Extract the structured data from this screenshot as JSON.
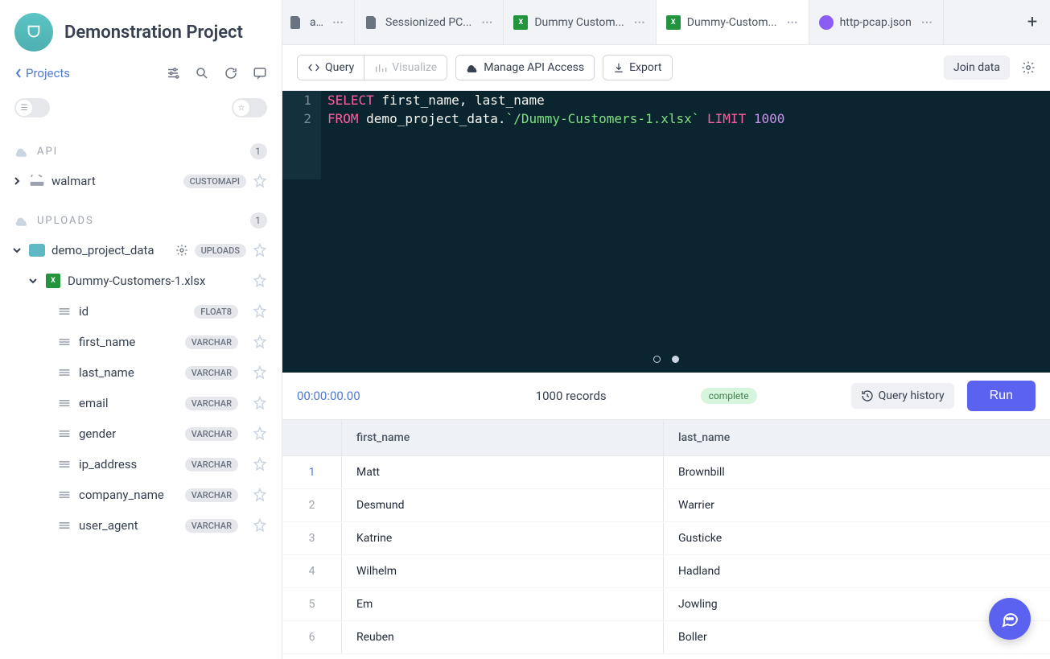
{
  "project": {
    "name": "Demonstration Project",
    "back_link": "Projects"
  },
  "sidebar": {
    "api_label": "API",
    "api_count": "1",
    "api_items": [
      {
        "name": "walmart",
        "badge": "CUSTOMAPI"
      }
    ],
    "uploads_label": "UPLOADS",
    "uploads_count": "1",
    "uploads_folder": {
      "name": "demo_project_data",
      "badge": "UPLOADS"
    },
    "file": {
      "name": "Dummy-Customers-1.xlsx"
    },
    "columns": [
      {
        "name": "id",
        "type": "FLOAT8"
      },
      {
        "name": "first_name",
        "type": "VARCHAR"
      },
      {
        "name": "last_name",
        "type": "VARCHAR"
      },
      {
        "name": "email",
        "type": "VARCHAR"
      },
      {
        "name": "gender",
        "type": "VARCHAR"
      },
      {
        "name": "ip_address",
        "type": "VARCHAR"
      },
      {
        "name": "company_name",
        "type": "VARCHAR"
      },
      {
        "name": "user_agent",
        "type": "VARCHAR"
      }
    ]
  },
  "tabs": [
    {
      "label": "ap.json",
      "icon": "file"
    },
    {
      "label": "Sessionized PC...",
      "icon": "file"
    },
    {
      "label": "Dummy Custom...",
      "icon": "excel"
    },
    {
      "label": "Dummy-Custom...",
      "icon": "excel",
      "active": true
    },
    {
      "label": "http-pcap.json",
      "icon": "circle"
    }
  ],
  "actions": {
    "query": "Query",
    "visualize": "Visualize",
    "manage_api": "Manage API Access",
    "export": "Export",
    "join": "Join data"
  },
  "editor": {
    "lines": [
      {
        "n": "1",
        "tokens": [
          [
            "kw-pink",
            "SELECT"
          ],
          [
            "kw-white",
            " first_name, last_name"
          ]
        ]
      },
      {
        "n": "2",
        "tokens": [
          [
            "kw-pink",
            "FROM"
          ],
          [
            "kw-white",
            " demo_project_data."
          ],
          [
            "kw-green",
            "`/Dummy-Customers-1.xlsx`"
          ],
          [
            "kw-white",
            " "
          ],
          [
            "kw-pink",
            "LIMIT"
          ],
          [
            "kw-white",
            " "
          ],
          [
            "kw-purple",
            "1000"
          ]
        ]
      }
    ]
  },
  "status": {
    "timer": "00:00:00.00",
    "records": "1000 records",
    "state": "complete",
    "history": "Query history",
    "run": "Run"
  },
  "table": {
    "headers": [
      "first_name",
      "last_name"
    ],
    "rows": [
      {
        "idx": "1",
        "first_name": "Matt",
        "last_name": "Brownbill"
      },
      {
        "idx": "2",
        "first_name": "Desmund",
        "last_name": "Warrier"
      },
      {
        "idx": "3",
        "first_name": "Katrine",
        "last_name": "Gusticke"
      },
      {
        "idx": "4",
        "first_name": "Wilhelm",
        "last_name": "Hadland"
      },
      {
        "idx": "5",
        "first_name": "Em",
        "last_name": "Jowling"
      },
      {
        "idx": "6",
        "first_name": "Reuben",
        "last_name": "Boller"
      }
    ]
  }
}
